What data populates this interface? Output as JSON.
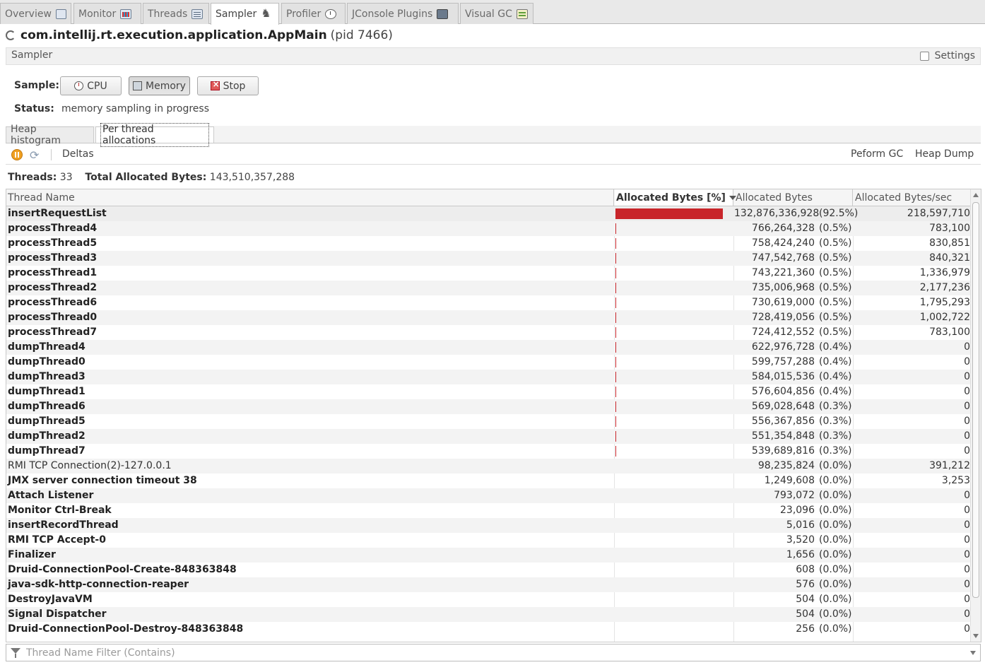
{
  "tabs": [
    {
      "label": "Overview",
      "icon": "overview-icon"
    },
    {
      "label": "Monitor",
      "icon": "monitor-icon"
    },
    {
      "label": "Threads",
      "icon": "threads-icon"
    },
    {
      "label": "Sampler",
      "icon": "sampler-icon",
      "active": true
    },
    {
      "label": "Profiler",
      "icon": "profiler-icon"
    },
    {
      "label": "JConsole Plugins",
      "icon": "jconsole-icon"
    },
    {
      "label": "Visual GC",
      "icon": "visualgc-icon"
    }
  ],
  "process": {
    "name": "com.intellij.rt.execution.application.AppMain",
    "pid": "(pid 7466)"
  },
  "sampler": {
    "header": "Sampler",
    "settings_label": "Settings",
    "settings_checked": false,
    "sample_label": "Sample:",
    "buttons": {
      "cpu": "CPU",
      "memory": "Memory",
      "stop": "Stop"
    },
    "status_label": "Status:",
    "status_value": "memory sampling in progress"
  },
  "subtabs": {
    "heap_histogram": "Heap histogram",
    "per_thread": "Per thread allocations"
  },
  "toolbar": {
    "deltas": "Deltas",
    "perform_gc": "Peform GC",
    "heap_dump": "Heap Dump"
  },
  "summary": {
    "threads_label": "Threads:",
    "threads_value": "33",
    "total_label": "Total Allocated Bytes:",
    "total_value": "143,510,357,288"
  },
  "table": {
    "columns": [
      "Thread Name",
      "Allocated Bytes [%]",
      "Allocated Bytes",
      "Allocated Bytes/sec"
    ],
    "bar_color": "#c8252a",
    "rows": [
      {
        "name": "insertRequestList",
        "fraction": 0.925,
        "bytes": "132,876,336,928",
        "pct": "(92.5%)",
        "rate": "218,597,710"
      },
      {
        "name": "processThread4",
        "fraction": 0.005,
        "bytes": "766,264,328",
        "pct": "(0.5%)",
        "rate": "783,100"
      },
      {
        "name": "processThread5",
        "fraction": 0.005,
        "bytes": "758,424,240",
        "pct": "(0.5%)",
        "rate": "830,851"
      },
      {
        "name": "processThread3",
        "fraction": 0.005,
        "bytes": "747,542,768",
        "pct": "(0.5%)",
        "rate": "840,321"
      },
      {
        "name": "processThread1",
        "fraction": 0.005,
        "bytes": "743,221,360",
        "pct": "(0.5%)",
        "rate": "1,336,979"
      },
      {
        "name": "processThread2",
        "fraction": 0.005,
        "bytes": "735,006,968",
        "pct": "(0.5%)",
        "rate": "2,177,236"
      },
      {
        "name": "processThread6",
        "fraction": 0.005,
        "bytes": "730,619,000",
        "pct": "(0.5%)",
        "rate": "1,795,293"
      },
      {
        "name": "processThread0",
        "fraction": 0.005,
        "bytes": "728,419,056",
        "pct": "(0.5%)",
        "rate": "1,002,722"
      },
      {
        "name": "processThread7",
        "fraction": 0.005,
        "bytes": "724,412,552",
        "pct": "(0.5%)",
        "rate": "783,100"
      },
      {
        "name": "dumpThread4",
        "fraction": 0.004,
        "bytes": "622,976,728",
        "pct": "(0.4%)",
        "rate": "0"
      },
      {
        "name": "dumpThread0",
        "fraction": 0.004,
        "bytes": "599,757,288",
        "pct": "(0.4%)",
        "rate": "0"
      },
      {
        "name": "dumpThread3",
        "fraction": 0.004,
        "bytes": "584,015,536",
        "pct": "(0.4%)",
        "rate": "0"
      },
      {
        "name": "dumpThread1",
        "fraction": 0.004,
        "bytes": "576,604,856",
        "pct": "(0.4%)",
        "rate": "0"
      },
      {
        "name": "dumpThread6",
        "fraction": 0.003,
        "bytes": "569,028,648",
        "pct": "(0.3%)",
        "rate": "0"
      },
      {
        "name": "dumpThread5",
        "fraction": 0.003,
        "bytes": "556,367,856",
        "pct": "(0.3%)",
        "rate": "0"
      },
      {
        "name": "dumpThread2",
        "fraction": 0.003,
        "bytes": "551,354,848",
        "pct": "(0.3%)",
        "rate": "0"
      },
      {
        "name": "dumpThread7",
        "fraction": 0.003,
        "bytes": "539,689,816",
        "pct": "(0.3%)",
        "rate": "0"
      },
      {
        "name": "RMI TCP Connection(2)-127.0.0.1",
        "plain": true,
        "fraction": 0,
        "bytes": "98,235,824",
        "pct": "(0.0%)",
        "rate": "391,212"
      },
      {
        "name": "JMX server connection timeout 38",
        "fraction": 0,
        "bytes": "1,249,608",
        "pct": "(0.0%)",
        "rate": "3,253"
      },
      {
        "name": "Attach Listener",
        "fraction": 0,
        "bytes": "793,072",
        "pct": "(0.0%)",
        "rate": "0"
      },
      {
        "name": "Monitor Ctrl-Break",
        "fraction": 0,
        "bytes": "23,096",
        "pct": "(0.0%)",
        "rate": "0"
      },
      {
        "name": "insertRecordThread",
        "fraction": 0,
        "bytes": "5,016",
        "pct": "(0.0%)",
        "rate": "0"
      },
      {
        "name": "RMI TCP Accept-0",
        "fraction": 0,
        "bytes": "3,520",
        "pct": "(0.0%)",
        "rate": "0"
      },
      {
        "name": "Finalizer",
        "fraction": 0,
        "bytes": "1,656",
        "pct": "(0.0%)",
        "rate": "0"
      },
      {
        "name": "Druid-ConnectionPool-Create-848363848",
        "fraction": 0,
        "bytes": "608",
        "pct": "(0.0%)",
        "rate": "0"
      },
      {
        "name": "java-sdk-http-connection-reaper",
        "fraction": 0,
        "bytes": "576",
        "pct": "(0.0%)",
        "rate": "0"
      },
      {
        "name": "DestroyJavaVM",
        "fraction": 0,
        "bytes": "504",
        "pct": "(0.0%)",
        "rate": "0"
      },
      {
        "name": "Signal Dispatcher",
        "fraction": 0,
        "bytes": "504",
        "pct": "(0.0%)",
        "rate": "0"
      },
      {
        "name": "Druid-ConnectionPool-Destroy-848363848",
        "fraction": 0,
        "bytes": "256",
        "pct": "(0.0%)",
        "rate": "0"
      }
    ]
  },
  "filter": {
    "placeholder": "Thread Name Filter (Contains)",
    "value": ""
  }
}
